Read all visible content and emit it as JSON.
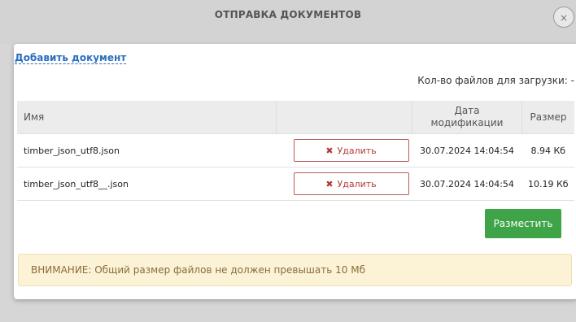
{
  "header": {
    "title": "ОТПРАВКА ДОКУМЕНТОВ",
    "close_symbol": "×"
  },
  "actions": {
    "add_document": "Добавить документ"
  },
  "upload_info": {
    "files_count_label": "Кол-во файлов для загрузки: -"
  },
  "table": {
    "columns": {
      "name": "Имя",
      "modified": "Дата модификации",
      "size": "Размер"
    },
    "rows": [
      {
        "name": "timber_json_utf8.json",
        "delete_label": "Удалить",
        "modified": "30.07.2024 14:04:54",
        "size": "8.94 Кб"
      },
      {
        "name": "timber_json_utf8__.json",
        "delete_label": "Удалить",
        "modified": "30.07.2024 14:04:54",
        "size": "10.19 Кб"
      }
    ]
  },
  "buttons": {
    "place": "Разместить"
  },
  "warning": {
    "text": "ВНИМАНИЕ: Общий размер файлов не должен превышать 10 Мб"
  },
  "icons": {
    "delete": "x-mark-icon",
    "close": "close-icon"
  },
  "colors": {
    "link": "#2a6fbf",
    "place_button": "#3fa348",
    "delete_border": "#b85a5a",
    "warning_bg": "#fcf2d6"
  }
}
